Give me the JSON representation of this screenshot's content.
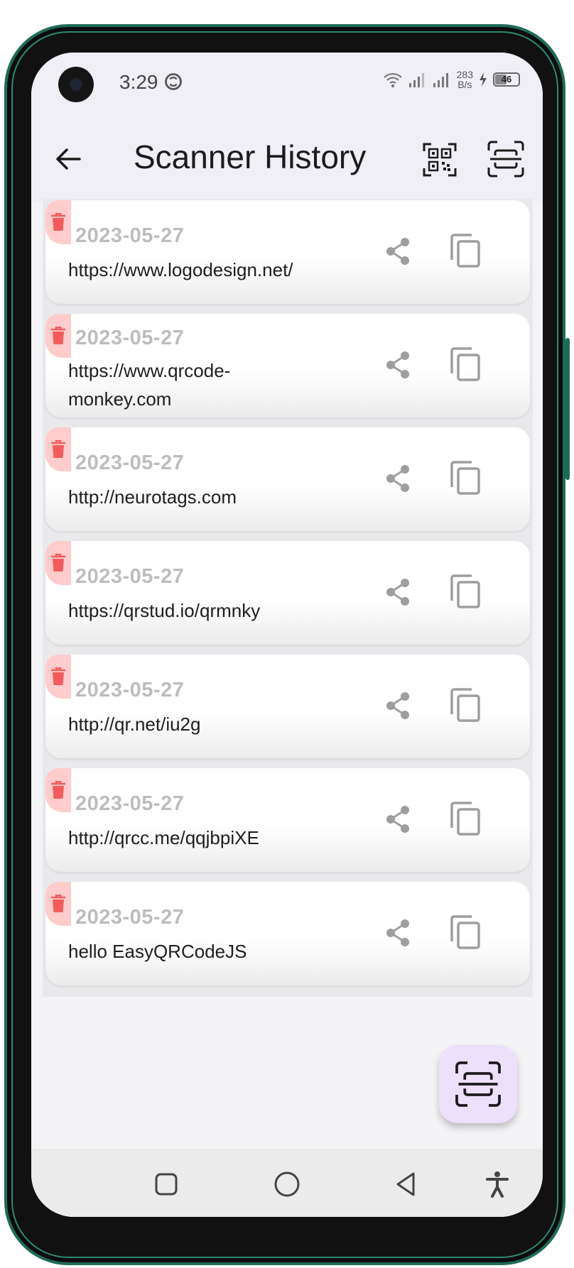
{
  "status_bar": {
    "time": "3:29",
    "net_speed_value": "283",
    "net_speed_unit": "B/s",
    "battery": "46"
  },
  "app_bar": {
    "title": "Scanner History",
    "back_icon": "arrow-left-icon",
    "qr_icon": "qr-code-icon",
    "scan_icon": "scan-frame-icon"
  },
  "history": [
    {
      "date": "2023-05-27",
      "content": "https://www.logodesign.net/"
    },
    {
      "date": "2023-05-27",
      "content": "https://www.qrcode-\nmonkey.com"
    },
    {
      "date": "2023-05-27",
      "content": "http://neurotags.com"
    },
    {
      "date": "2023-05-27",
      "content": "https://qrstud.io/qrmnky"
    },
    {
      "date": "2023-05-27",
      "content": "http://qr.net/iu2g"
    },
    {
      "date": "2023-05-27",
      "content": "http://qrcc.me/qqjbpiXE"
    },
    {
      "date": "2023-05-27",
      "content": "hello EasyQRCodeJS"
    }
  ],
  "colors": {
    "delete_bg": "#ffcccc",
    "delete_icon": "#f25c5c",
    "date_text": "#bdbdbd",
    "icon_gray": "#9e9e9e",
    "fab_bg": "#ece0fb",
    "app_bar_bg": "#f1eff6"
  },
  "nav_bar": {
    "items": [
      "recent-apps-icon",
      "home-icon",
      "back-icon",
      "accessibility-icon"
    ]
  }
}
